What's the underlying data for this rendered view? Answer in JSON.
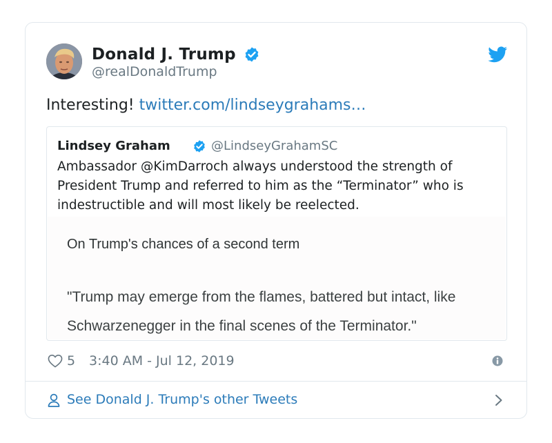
{
  "author": {
    "name": "Donald J. Trump",
    "handle": "@realDonaldTrump"
  },
  "tweet": {
    "text": "Interesting!",
    "link": "twitter.com/lindseygrahams…"
  },
  "quoted_tweet": {
    "name": "Lindsey Graham",
    "handle": "@LindseyGrahamSC",
    "text": "Ambassador @KimDarroch always understood the strength of President Trump and referred to him as the “Terminator” who is indestructible and will most likely be reelected.",
    "media_heading": "On Trump's chances of a second term",
    "media_quote": "\"Trump may emerge from the flames, battered but intact, like Schwarzenegger in the final scenes of the Terminator.\""
  },
  "meta": {
    "like_count": "5",
    "timestamp": "3:40 AM - Jul 12, 2019"
  },
  "footer": {
    "label": "See Donald J. Trump's other Tweets"
  },
  "icons": {
    "verified": "verified-badge-icon",
    "brand": "twitter-bird-icon",
    "like": "heart-icon",
    "info": "info-icon",
    "profile": "person-icon",
    "more": "chevron-right-icon"
  },
  "colors": {
    "link": "#2b7bb9",
    "verified": "#1da1f2",
    "muted": "#697882",
    "border": "#e1e8ed"
  }
}
